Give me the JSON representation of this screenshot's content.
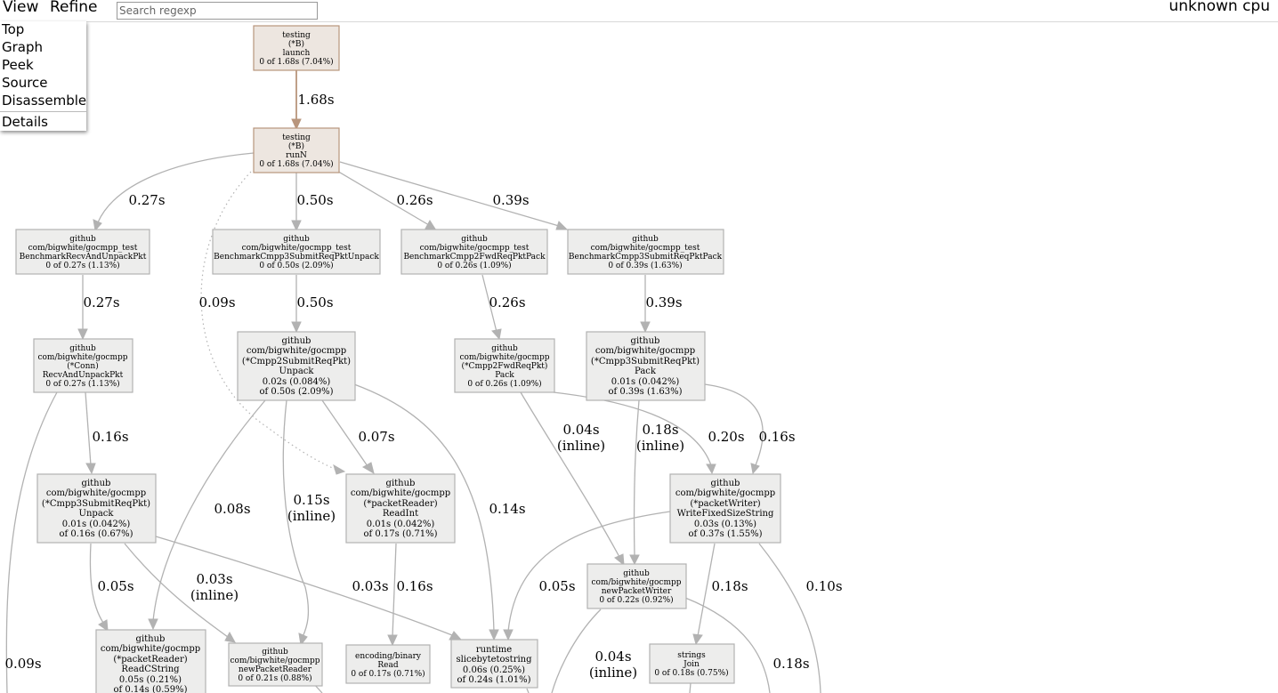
{
  "toolbar": {
    "view_label": "View",
    "refine_label": "Refine",
    "search_placeholder": "Search regexp",
    "legend": "unknown cpu"
  },
  "view_menu": {
    "items": [
      "Top",
      "Graph",
      "Peek",
      "Source",
      "Disassemble"
    ],
    "details": "Details"
  },
  "graph": {
    "nodes": {
      "launch": [
        "testing",
        "(*B)",
        "launch",
        "0 of 1.68s (7.04%)"
      ],
      "runN": [
        "testing",
        "(*B)",
        "runN",
        "0 of 1.68s (7.04%)"
      ],
      "bench_recv": [
        "github",
        "com/bigwhite/gocmpp_test",
        "BenchmarkRecvAndUnpackPkt",
        "0 of 0.27s (1.13%)"
      ],
      "bench_c3unpack": [
        "github",
        "com/bigwhite/gocmpp_test",
        "BenchmarkCmpp3SubmitReqPktUnpack",
        "0 of 0.50s (2.09%)"
      ],
      "bench_c2pack": [
        "github",
        "com/bigwhite/gocmpp_test",
        "BenchmarkCmpp2FwdReqPktPack",
        "0 of 0.26s (1.09%)"
      ],
      "bench_c3pack": [
        "github",
        "com/bigwhite/gocmpp_test",
        "BenchmarkCmpp3SubmitReqPktPack",
        "0 of 0.39s (1.63%)"
      ],
      "conn_recv": [
        "github",
        "com/bigwhite/gocmpp",
        "(*Conn)",
        "RecvAndUnpackPkt",
        "0 of 0.27s (1.13%)"
      ],
      "c2submit_unpack": [
        "github",
        "com/bigwhite/gocmpp",
        "(*Cmpp2SubmitReqPkt)",
        "Unpack",
        "0.02s (0.084%)",
        "of 0.50s (2.09%)"
      ],
      "c2fwd_pack": [
        "github",
        "com/bigwhite/gocmpp",
        "(*Cmpp2FwdReqPkt)",
        "Pack",
        "0 of 0.26s (1.09%)"
      ],
      "c3submit_pack": [
        "github",
        "com/bigwhite/gocmpp",
        "(*Cmpp3SubmitReqPkt)",
        "Pack",
        "0.01s (0.042%)",
        "of 0.39s (1.63%)"
      ],
      "c3submit_unpack": [
        "github",
        "com/bigwhite/gocmpp",
        "(*Cmpp3SubmitReqPkt)",
        "Unpack",
        "0.01s (0.042%)",
        "of 0.16s (0.67%)"
      ],
      "reader_readint": [
        "github",
        "com/bigwhite/gocmpp",
        "(*packetReader)",
        "ReadInt",
        "0.01s (0.042%)",
        "of 0.17s (0.71%)"
      ],
      "writer_wfs": [
        "github",
        "com/bigwhite/gocmpp",
        "(*packetWriter)",
        "WriteFixedSizeString",
        "0.03s (0.13%)",
        "of 0.37s (1.55%)"
      ],
      "new_writer": [
        "github",
        "com/bigwhite/gocmpp",
        "newPacketWriter",
        "0 of 0.22s (0.92%)"
      ],
      "reader_readcstring": [
        "github",
        "com/bigwhite/gocmpp",
        "(*packetReader)",
        "ReadCString",
        "0.05s (0.21%)",
        "of 0.14s (0.59%)"
      ],
      "new_reader": [
        "github",
        "com/bigwhite/gocmpp",
        "newPacketReader",
        "0 of 0.21s (0.88%)"
      ],
      "binary_read": [
        "encoding/binary",
        "Read",
        "0 of 0.17s (0.71%)"
      ],
      "slicebyte": [
        "runtime",
        "slicebytetostring",
        "0.06s (0.25%)",
        "of 0.24s (1.01%)"
      ],
      "strings_join": [
        "strings",
        "Join",
        "0 of 0.18s (0.75%)"
      ]
    },
    "edges": {
      "launch_runN": [
        "1.68s"
      ],
      "runN_recv": [
        "0.27s"
      ],
      "runN_c3unpack": [
        "0.50s"
      ],
      "runN_c2pack": [
        "0.26s"
      ],
      "runN_c3pack": [
        "0.39s"
      ],
      "runN_readint": [
        "0.09s"
      ],
      "recv_conn": [
        "0.27s"
      ],
      "c3unpack_c2unpack": [
        "0.50s"
      ],
      "c2pack_fwd": [
        "0.26s"
      ],
      "c3pack_c3p": [
        "0.39s"
      ],
      "conn_c3unpack": [
        "0.16s"
      ],
      "conn_down": [
        "0.09s"
      ],
      "c2unpack_readcstring": [
        "0.08s"
      ],
      "c2unpack_newreader": [
        "0.15s",
        "(inline)"
      ],
      "c2unpack_readint": [
        "0.07s"
      ],
      "c2unpack_slice": [
        "0.14s"
      ],
      "fwd_newwriter": [
        "0.04s",
        "(inline)"
      ],
      "c3p_newwriter": [
        "0.18s",
        "(inline)"
      ],
      "fwd_wfs": [
        "0.20s"
      ],
      "c3p_wfs": [
        "0.16s"
      ],
      "c3u_readcstring": [
        "0.05s"
      ],
      "c3u_newreader": [
        "0.03s",
        "(inline)"
      ],
      "c3u_slice": [
        "0.03s"
      ],
      "readint_binary": [
        "0.16s"
      ],
      "wfs_slice": [
        "0.05s"
      ],
      "wfs_join": [
        "0.18s"
      ],
      "wfs_down": [
        "0.10s"
      ],
      "newwriter_down": [
        "0.04s",
        "(inline)"
      ],
      "newwriter_right": [
        "0.18s"
      ]
    }
  }
}
